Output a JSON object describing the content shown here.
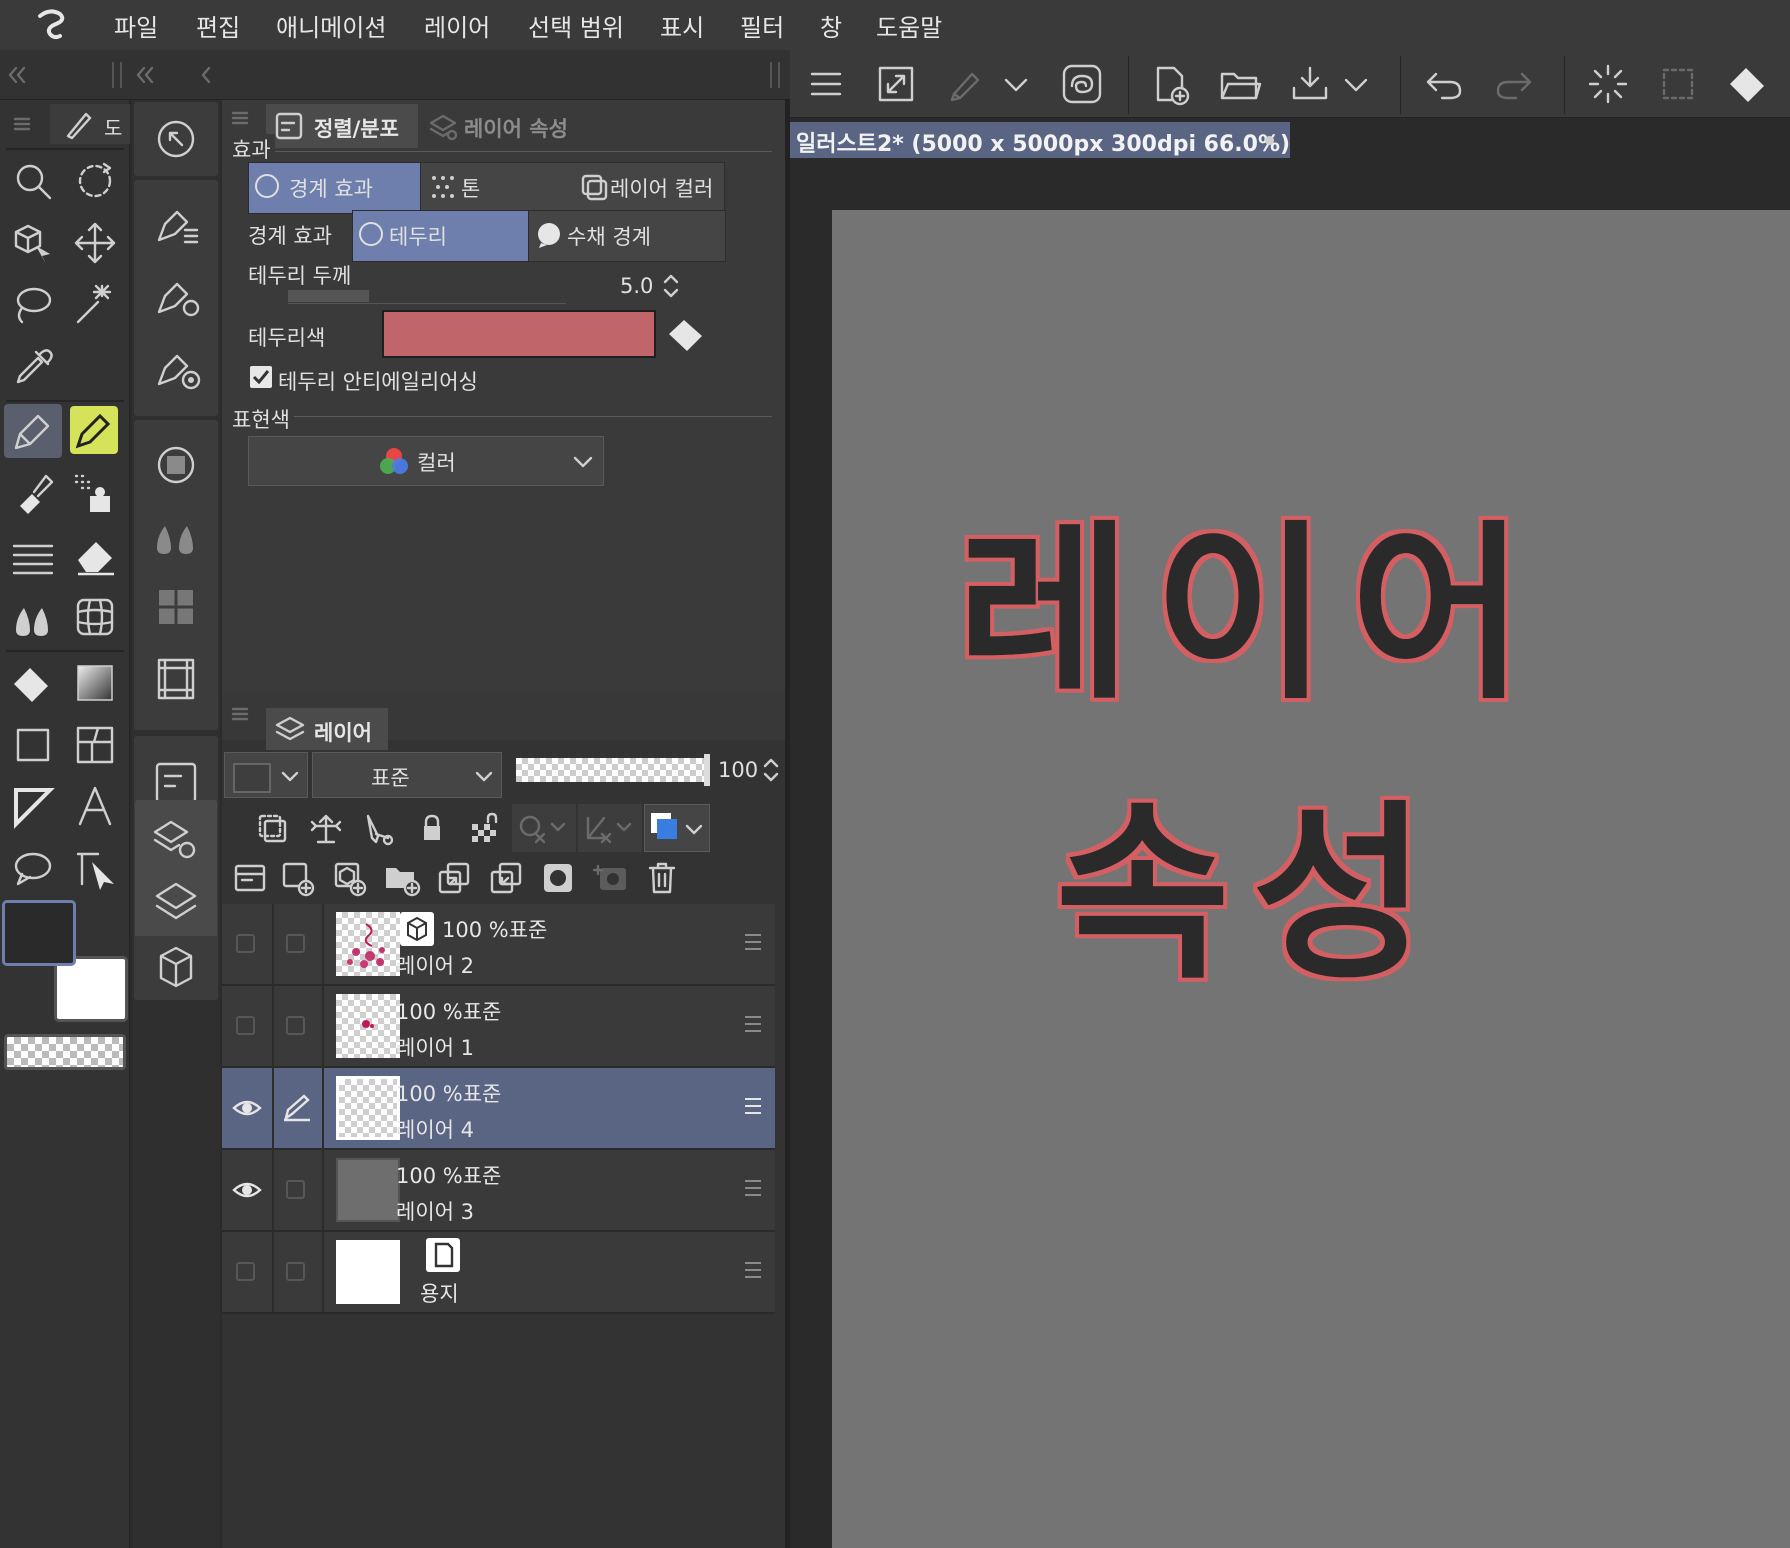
{
  "menu": {
    "items": [
      "파일",
      "편집",
      "애니메이션",
      "레이어",
      "선택 범위",
      "표시",
      "필터",
      "창",
      "도움말"
    ]
  },
  "tool_palette": {
    "tab_label": "도",
    "tools": [
      "zoom-icon",
      "rotate-icon",
      "object-icon",
      "move-icon",
      "lasso-select-icon",
      "magic-wand-icon",
      "eyedropper-icon",
      "pen-icon",
      "marker-icon",
      "brush-icon",
      "airbrush-icon",
      "decoration-icon",
      "eraser-icon",
      "blend-icon",
      "mesh-icon",
      "fill-icon",
      "gradient-icon",
      "figure-icon",
      "frame-icon",
      "ruler-icon",
      "text-icon",
      "balloon-icon",
      "line-adjust-icon"
    ],
    "main_color": "#2a2a2a",
    "sub_color": "#ffffff"
  },
  "property_panel": {
    "tabs": [
      "정렬/분포",
      "레이어 속성"
    ],
    "effect_section": "효과",
    "effects": [
      "경계 효과",
      "톤",
      "레이어 컬러"
    ],
    "border_effect_label": "경계 효과",
    "border_options": [
      "테두리",
      "수채 경계"
    ],
    "thickness_label": "테두리 두께",
    "thickness_value": "5.0",
    "thickness_fraction": 0.29,
    "color_label": "테두리색",
    "border_color": "#c0666a",
    "antialias_label": "테두리 안티에일리어싱",
    "antialias_checked": true,
    "expression_section": "표현색",
    "expression_value": "컬러"
  },
  "layer_panel": {
    "title": "레이어",
    "blend_mode": "표준",
    "opacity": "100",
    "opacity_fraction": 1.0,
    "layers": [
      {
        "mode": "100 %표준",
        "name": "레이어 2",
        "visible": false,
        "editing": false,
        "selected": false,
        "badge": "3d-icon"
      },
      {
        "mode": "100 %표준",
        "name": "레이어 1",
        "visible": false,
        "editing": false,
        "selected": false
      },
      {
        "mode": "100 %표준",
        "name": "레이어 4",
        "visible": true,
        "editing": true,
        "selected": true
      },
      {
        "mode": "100 %표준",
        "name": "레이어 3",
        "visible": true,
        "editing": false,
        "selected": false
      },
      {
        "mode": "",
        "name": "용지",
        "visible": false,
        "editing": false,
        "selected": false,
        "badge": "paper-icon"
      }
    ]
  },
  "document": {
    "tab_title": "일러스트2* (5000 x 5000px 300dpi 66.0%)",
    "canvas_text": [
      "레이어",
      "속성"
    ],
    "canvas_text_color": "#2c2c2c",
    "canvas_outline_color": "#d35f63"
  }
}
